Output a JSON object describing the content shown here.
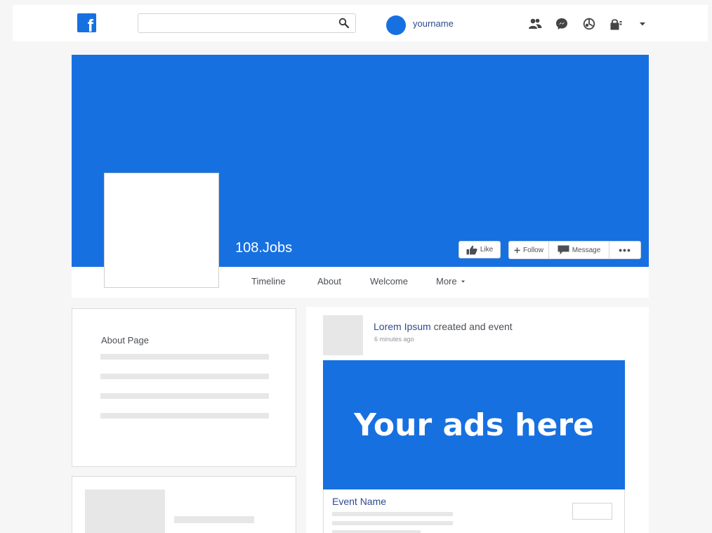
{
  "topbar": {
    "logo_letter": "f",
    "search_placeholder": "",
    "search_value": "",
    "username": "yourname",
    "icons": [
      "friends-icon",
      "messenger-icon",
      "notifications-icon",
      "lock-icon",
      "dropdown-arrow-icon"
    ]
  },
  "page": {
    "name": "108.Jobs",
    "buttons": {
      "like": "Like",
      "follow": "Follow",
      "message": "Message",
      "more_dots": "•••"
    },
    "tabs": [
      "Timeline",
      "About",
      "Welcome",
      "More"
    ]
  },
  "about": {
    "title": "About Page"
  },
  "post": {
    "author": "Lorem Ipsum",
    "action": "created and event",
    "time": "6 minutes ago",
    "ad_text": "Your ads here",
    "event_name": "Event Name"
  },
  "colors": {
    "brand_blue": "#1770e0",
    "link_blue": "#2f4a8e",
    "placeholder_gray": "#e7e7e7",
    "background": "#f6f6f6"
  }
}
